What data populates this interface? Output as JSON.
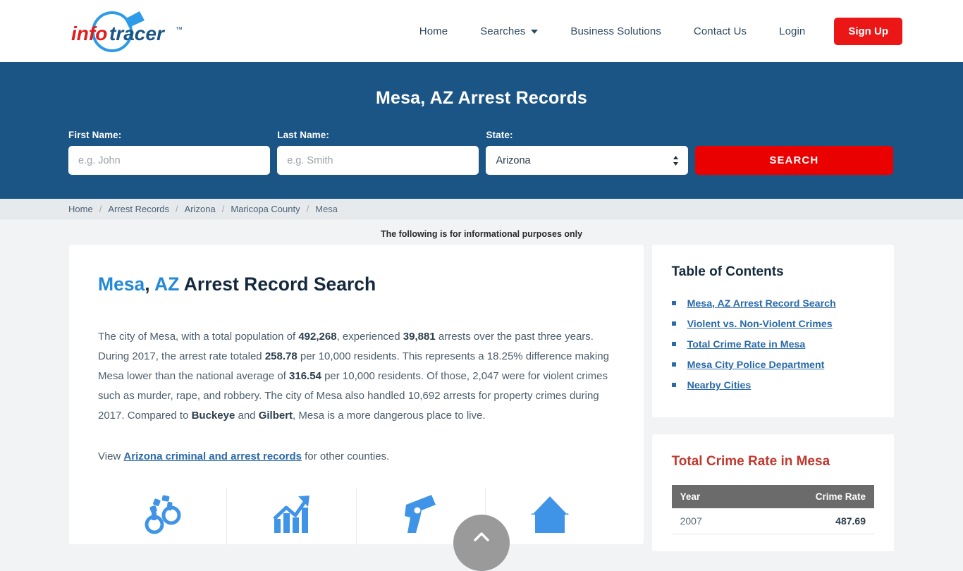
{
  "header": {
    "logo_alt": "infotracer",
    "logo_text_info": "info",
    "logo_text_tracer": "tracer",
    "logo_tm": "™",
    "nav": [
      {
        "label": "Home",
        "name": "nav-home",
        "caret": false
      },
      {
        "label": "Searches",
        "name": "nav-searches",
        "caret": true
      },
      {
        "label": "Business Solutions",
        "name": "nav-business-solutions",
        "caret": false
      },
      {
        "label": "Contact Us",
        "name": "nav-contact-us",
        "caret": false
      },
      {
        "label": "Login",
        "name": "nav-login",
        "caret": false
      }
    ],
    "signup_label": "Sign Up",
    "brand_red": "#eb1616"
  },
  "band": {
    "title": "Mesa, AZ Arrest Records",
    "background": "#1b5585",
    "first_name_label": "First Name:",
    "first_name_placeholder": "e.g. John",
    "first_name_value": "",
    "last_name_label": "Last Name:",
    "last_name_placeholder": "e.g. Smith",
    "last_name_value": "",
    "state_label": "State:",
    "state_value": "Arizona",
    "state_options": [
      "Arizona"
    ],
    "search_label": "SEARCH",
    "search_button_color": "#eb0000"
  },
  "breadcrumb": {
    "items": [
      "Home",
      "Arrest Records",
      "Arizona",
      "Maricopa County",
      "Mesa"
    ],
    "separator": "/"
  },
  "notice": "The following is for informational purposes only",
  "main": {
    "heading_city": "Mesa",
    "heading_comma": ", ",
    "heading_state": "AZ",
    "heading_rest": " Arrest Record Search",
    "paragraph": {
      "p1_a": "The city of Mesa, with a total population of ",
      "population": "492,268",
      "p1_b": ", experienced ",
      "arrests": "39,881",
      "p1_c": " arrests over the past three years. During 2017, the arrest rate totaled ",
      "arrest_rate": "258.78",
      "p1_d": " per 10,000 residents. This represents a 18.25% difference making Mesa lower than the national average of ",
      "national_average": "316.54",
      "p1_e": " per 10,000 residents. Of those, 2,047 were for violent crimes such as murder, rape, and robbery. The city of Mesa also handled 10,692 arrests for property crimes during 2017. Compared to ",
      "city_a": "Buckeye",
      "p1_f": " and ",
      "city_b": "Gilbert",
      "p1_g": ", Mesa is a more dangerous place to live."
    },
    "view_prefix": "View ",
    "view_link": "Arizona criminal and arrest records",
    "view_suffix": " for other counties.",
    "icons": [
      {
        "name": "handcuffs-icon"
      },
      {
        "name": "growth-chart-icon"
      },
      {
        "name": "handgun-icon"
      },
      {
        "name": "house-icon"
      }
    ]
  },
  "sidebar": {
    "toc_title": "Table of Contents",
    "toc_items": [
      "Mesa, AZ Arrest Record Search",
      "Violent vs. Non-Violent Crimes",
      "Total Crime Rate in Mesa",
      "Mesa City Police Department",
      "Nearby Cities"
    ],
    "crime_title": "Total Crime Rate in Mesa",
    "crime_title_color": "#c0392f",
    "table": {
      "columns": [
        "Year",
        "Crime Rate"
      ],
      "rows": [
        {
          "year": "2007",
          "rate": "487.69"
        }
      ]
    }
  },
  "scroll_top": {
    "name": "scroll-to-top-button"
  }
}
